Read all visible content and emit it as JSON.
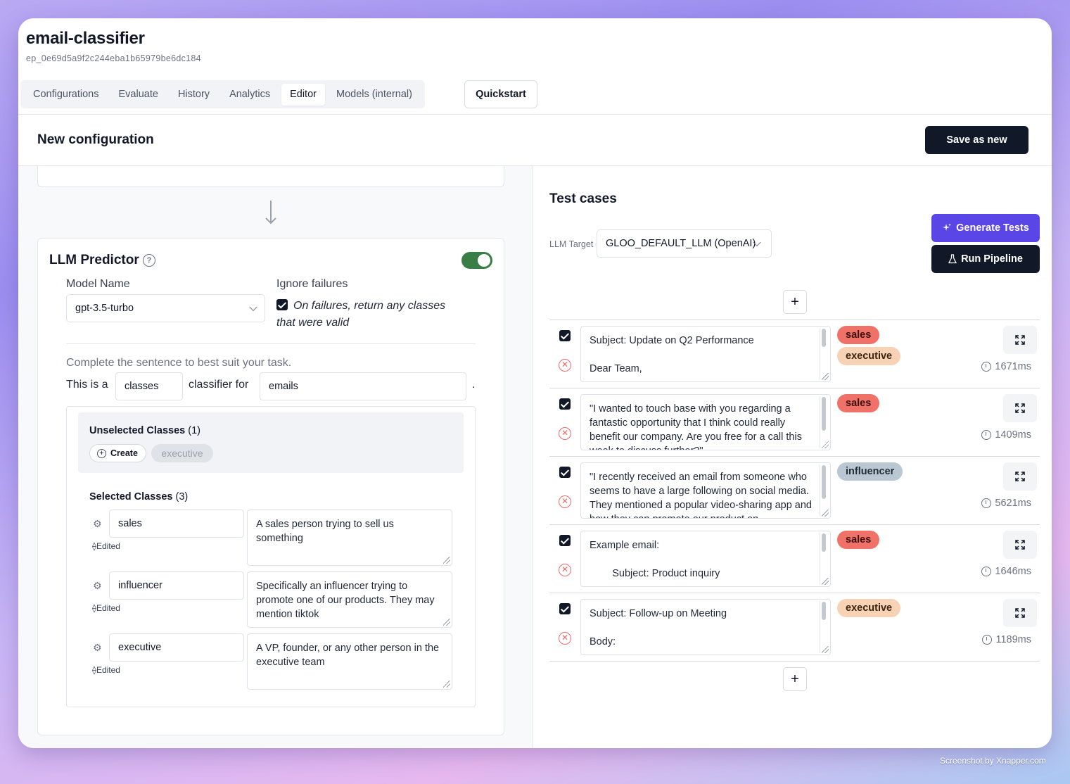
{
  "app": {
    "title": "email-classifier",
    "id": "ep_0e69d5a9f2c244eba1b65979be6dc184"
  },
  "tabs": [
    {
      "label": "Configurations"
    },
    {
      "label": "Evaluate"
    },
    {
      "label": "History"
    },
    {
      "label": "Analytics"
    },
    {
      "label": "Editor",
      "active": true
    },
    {
      "label": "Models (internal)"
    }
  ],
  "quickstart_label": "Quickstart",
  "config": {
    "title": "New configuration",
    "save_label": "Save as new"
  },
  "predictor": {
    "title": "LLM Predictor",
    "enabled": true,
    "model_label": "Model Name",
    "model_value": "gpt-3.5-turbo",
    "ignore_label": "Ignore failures",
    "ignore_checked": true,
    "ignore_text_1": "On failures, return any classes",
    "ignore_text_2": "that were valid",
    "sentence_note": "Complete the sentence to best suit your task.",
    "sentence_prefix": "This is a",
    "sentence_field_1": "classes",
    "sentence_middle": "classifier for",
    "sentence_field_2": "emails",
    "sentence_end": ".",
    "unselected_title": "Unselected Classes",
    "unselected_count": "(1)",
    "create_label": "Create",
    "unselected_chip": "executive",
    "selected_title": "Selected Classes",
    "selected_count": "(3)",
    "edited_label": "Edited",
    "classes": [
      {
        "name": "sales",
        "description": "A sales person trying to sell us something"
      },
      {
        "name": "influencer",
        "description": "Specifically an influencer trying to promote one of our products. They may mention tiktok"
      },
      {
        "name": "executive",
        "description": "A VP, founder, or any other person in the executive team"
      }
    ]
  },
  "test_cases": {
    "title": "Test cases",
    "llm_target_label": "LLM Target",
    "llm_target_value": "GLOO_DEFAULT_LLM (OpenAI)",
    "generate_label": "Generate Tests",
    "run_label": "Run Pipeline",
    "plus_symbol": "+",
    "rows": [
      {
        "text": "Subject: Update on Q2 Performance\n\nDear Team,",
        "tags": [
          "sales",
          "executive"
        ],
        "ms": "1671ms"
      },
      {
        "text": "\"I wanted to touch base with you regarding a fantastic opportunity that I think could really benefit our company. Are you free for a call this week to discuss further?\"",
        "tags": [
          "sales"
        ],
        "ms": "1409ms"
      },
      {
        "text": "\"I recently received an email from someone who seems to have a large following on social media. They mentioned a popular video-sharing app and how they can promote our product on",
        "tags": [
          "influencer"
        ],
        "ms": "5621ms"
      },
      {
        "text": "Example email:\n\n        Subject: Product inquiry",
        "tags": [
          "sales"
        ],
        "ms": "1646ms"
      },
      {
        "text": "Subject: Follow-up on Meeting\n\nBody:",
        "tags": [
          "executive"
        ],
        "ms": "1189ms"
      }
    ]
  },
  "footer_credit": "Screenshot by Xnapper.com",
  "colors": {
    "accent_purple": "#5a45e6",
    "dark": "#111827",
    "toggle_green": "#3b7d46",
    "tag_sales": "#f07167",
    "tag_executive": "#f7d2b5",
    "tag_influencer": "#b8c7d2"
  }
}
